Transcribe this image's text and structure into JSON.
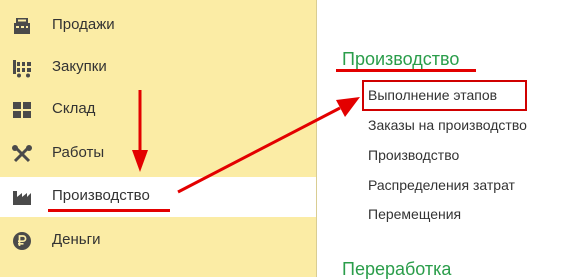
{
  "sidebar": {
    "items": [
      {
        "label": "Продажи",
        "icon": "sales-icon"
      },
      {
        "label": "Закупки",
        "icon": "purchases-icon"
      },
      {
        "label": "Склад",
        "icon": "warehouse-icon"
      },
      {
        "label": "Работы",
        "icon": "tools-icon"
      },
      {
        "label": "Производство",
        "icon": "factory-icon",
        "active": true
      },
      {
        "label": "Деньги",
        "icon": "ruble-icon"
      }
    ]
  },
  "main": {
    "sections": [
      {
        "title": "Производство",
        "items": [
          "Выполнение этапов",
          "Заказы на производство",
          "Производство",
          "Распределения затрат",
          "Перемещения"
        ]
      },
      {
        "title": "Переработка",
        "items": []
      }
    ]
  },
  "colors": {
    "sidebar_bg": "#fbeca5",
    "section_title": "#2a9d4a",
    "annotation_red": "#e30000",
    "text": "#333333"
  }
}
